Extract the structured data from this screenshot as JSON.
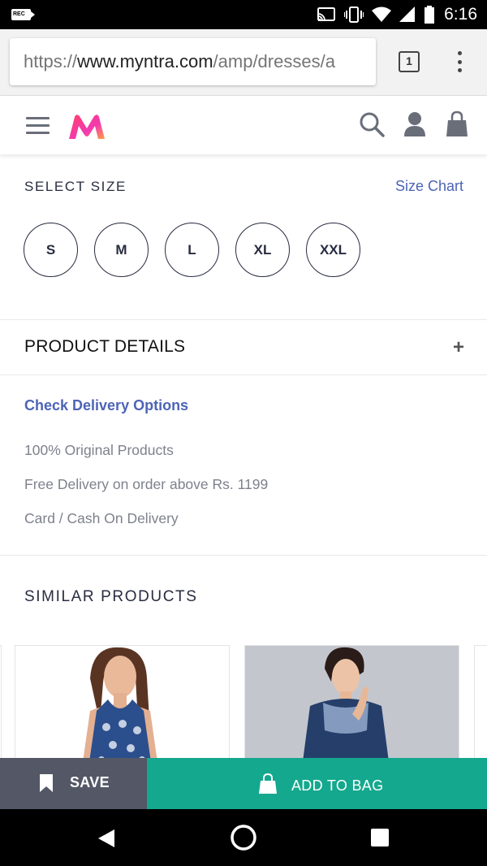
{
  "status_bar": {
    "time": "6:16",
    "rec_label": "REC"
  },
  "browser": {
    "url_scheme": "https://",
    "url_host": "www.myntra.com",
    "url_path": "/amp/dresses/a",
    "tab_count": "1"
  },
  "header": {
    "logo_text": "M"
  },
  "size_section": {
    "heading": "SELECT SIZE",
    "size_chart_link": "Size Chart",
    "sizes": [
      "S",
      "M",
      "L",
      "XL",
      "XXL"
    ]
  },
  "product_details": {
    "title": "PRODUCT DETAILS",
    "expand_symbol": "+"
  },
  "delivery": {
    "check_link": "Check Delivery Options",
    "features": [
      "100% Original Products",
      "Free Delivery on order above Rs. 1199",
      "Card / Cash On Delivery"
    ]
  },
  "similar_products": {
    "heading": "SIMILAR PRODUCTS"
  },
  "actions": {
    "save_label": "SAVE",
    "add_to_bag_label": "ADD TO BAG"
  },
  "colors": {
    "brand_link": "#4d64b6",
    "add_to_bag": "#14a88e",
    "save": "#535766",
    "logo_pink": "#ff3f6c",
    "logo_orange": "#ff9f43"
  }
}
